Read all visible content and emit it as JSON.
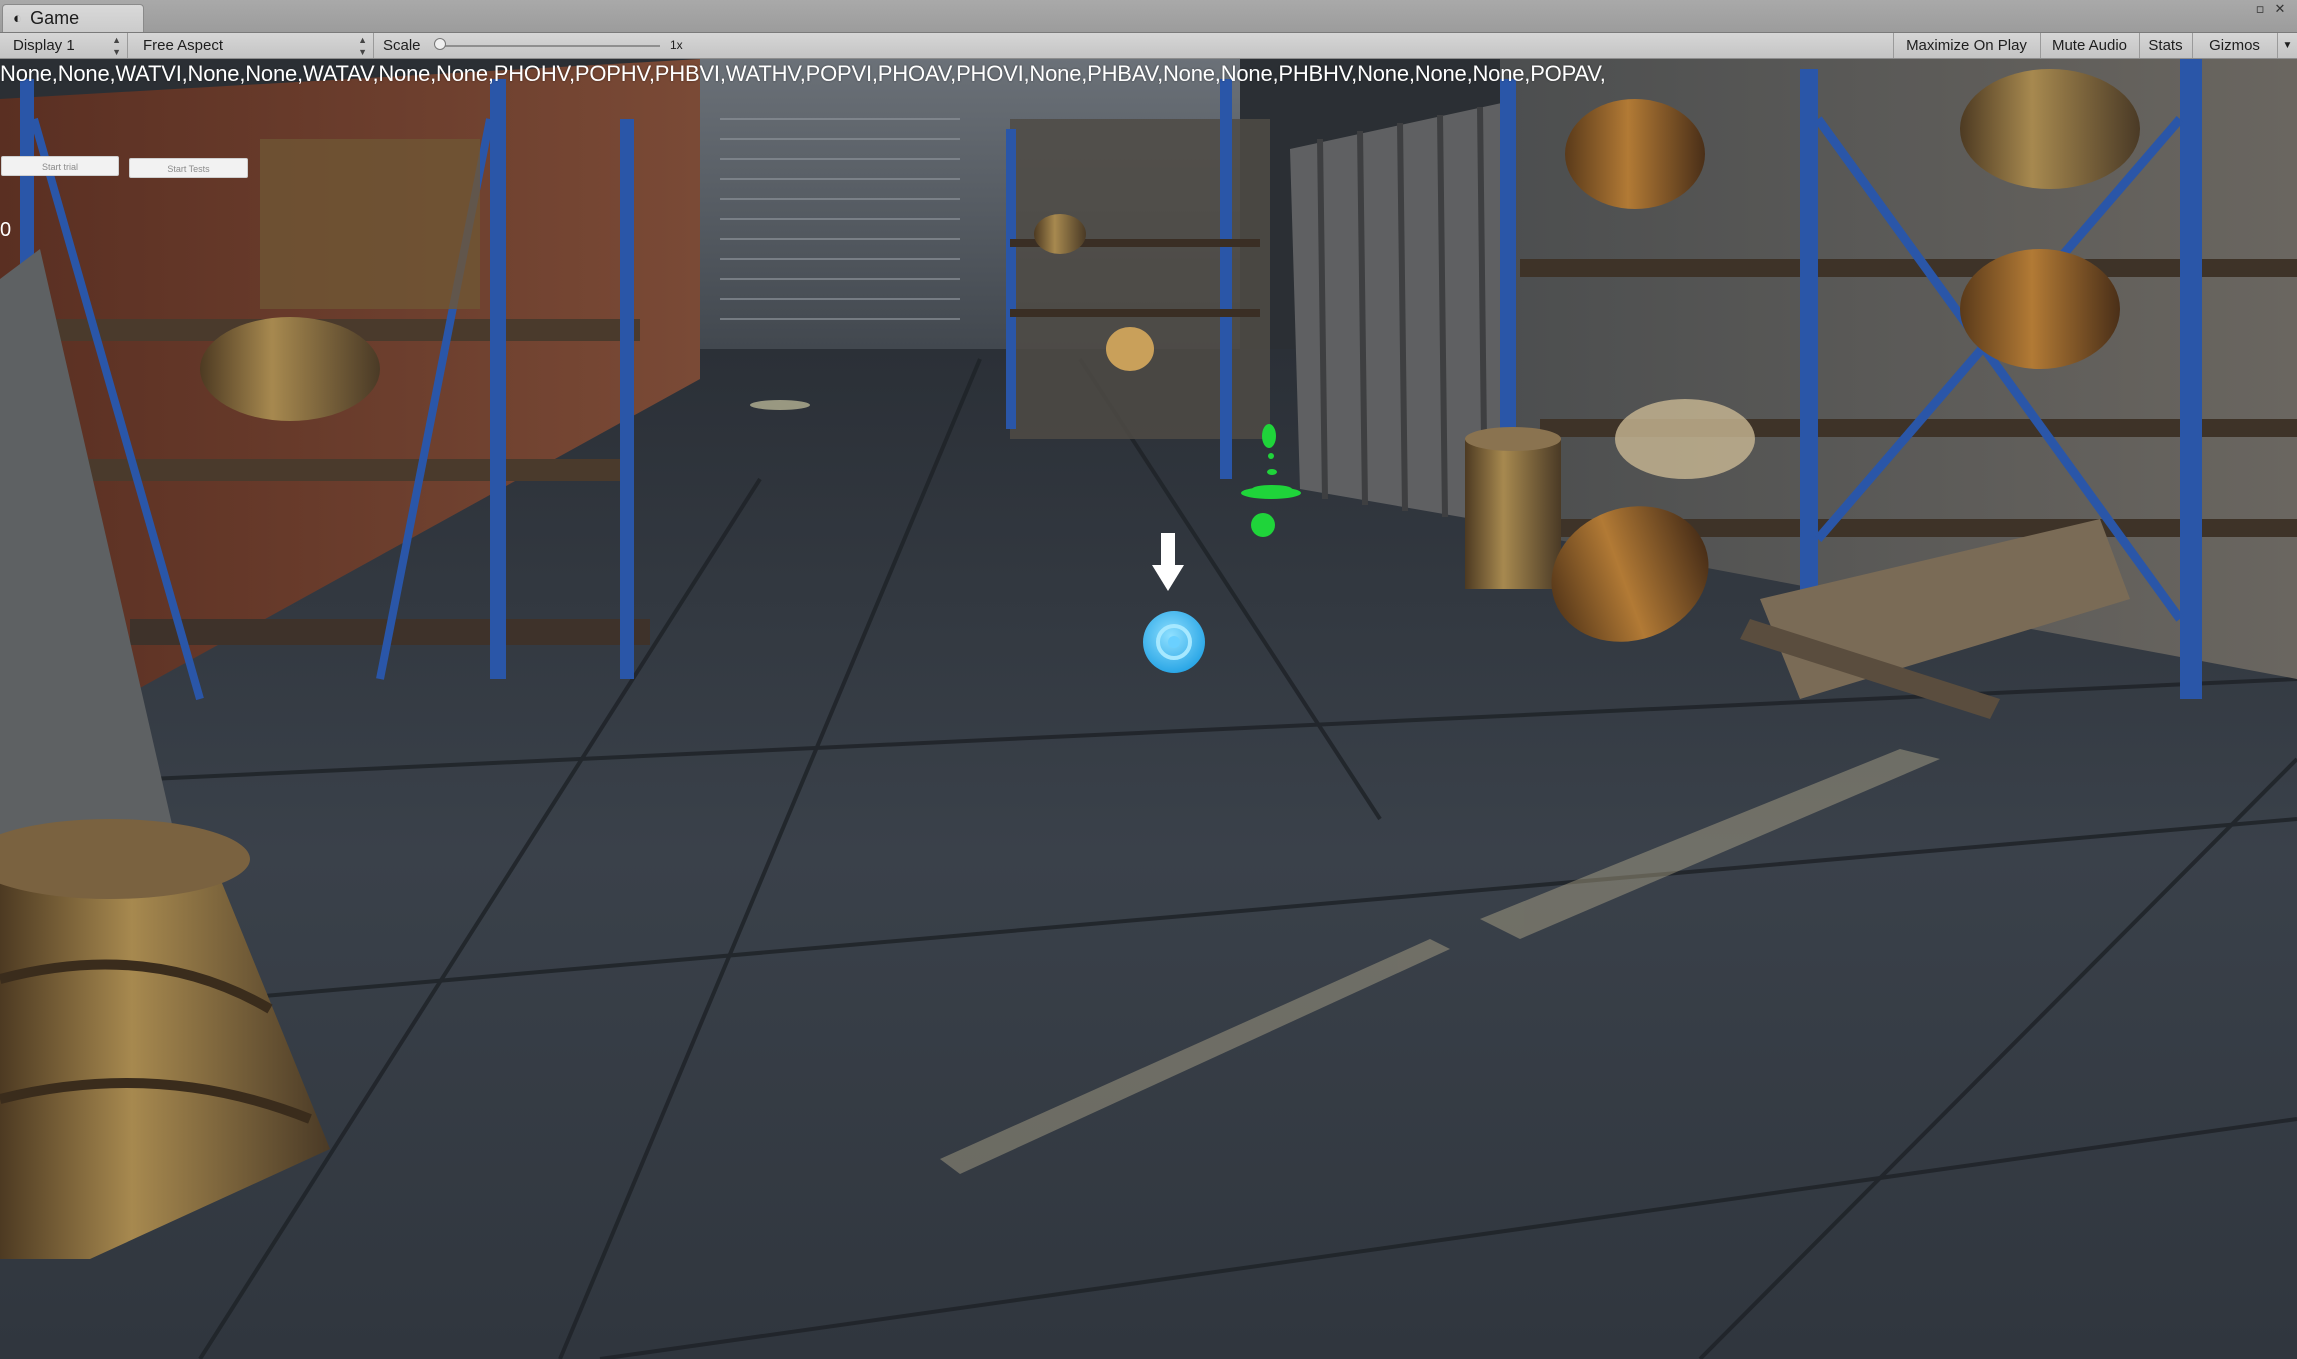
{
  "window": {
    "tab_title": "Game",
    "tab_icon": "unity-game-icon",
    "controls": [
      "maximize-icon",
      "close-icon"
    ]
  },
  "toolbar": {
    "display": "Display 1",
    "aspect": "Free Aspect",
    "scale_label": "Scale",
    "scale_value": "1x",
    "scale_fraction": 0.0,
    "maximize_on_play": "Maximize On Play",
    "mute_audio": "Mute Audio",
    "stats": "Stats",
    "gizmos": "Gizmos"
  },
  "game": {
    "status_sequence": "None,None,WATVI,None,None,WATAV,None,None,PHOHV,POPHV,PHBVI,WATHV,POPVI,PHOAV,PHOVI,None,PHBAV,None,None,PHBHV,None,None,None,POPAV,",
    "start_trial_button": "Start trial",
    "start_tests_button": "Start Tests",
    "counter": "0"
  },
  "scene": {
    "icons": [
      "down-arrow-icon",
      "target-circle-icon",
      "green-beacon-icon"
    ],
    "colors": {
      "target": "#42b8f0",
      "beacon": "#1fd43a",
      "rack": "#2a56a8",
      "floor": "#3a4048",
      "wall": "#6a3a2a"
    }
  }
}
